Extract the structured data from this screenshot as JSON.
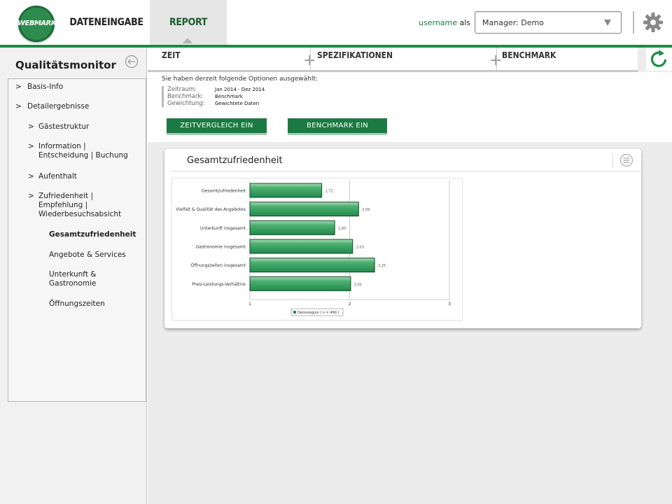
{
  "header": {
    "logo_text": "WEBMARK",
    "tabs": [
      {
        "label": "DATENEINGABE"
      },
      {
        "label": "REPORT"
      }
    ],
    "username_label": "username",
    "username_suffix": "als",
    "manager_select": {
      "value": "Manager: Demo"
    }
  },
  "sidebar": {
    "title": "Qualitätsmonitor",
    "items": [
      {
        "label": "Basis-Info"
      },
      {
        "label": "Detailergebnisse"
      },
      {
        "label": "Gästestruktur"
      },
      {
        "label": "Information |"
      },
      {
        "label": "Entscheidung | Buchung"
      },
      {
        "label": "Aufenthalt"
      },
      {
        "label": "Zufriedenheit |"
      },
      {
        "label": "Empfehlung |"
      },
      {
        "label": "Wiederbesuchsabsicht"
      },
      {
        "label": "Gesamtzufriedenheit"
      },
      {
        "label": "Angebote & Services"
      },
      {
        "label": "Unterkunft &"
      },
      {
        "label": "Gastronomie"
      },
      {
        "label": "Öffnungszeiten"
      }
    ]
  },
  "subtabs": [
    {
      "label": "ZEIT"
    },
    {
      "label": "SPEZIFIKATIONEN"
    },
    {
      "label": "BENCHMARK"
    }
  ],
  "options": {
    "title": "Sie haben derzeit folgende Optionen ausgewählt:",
    "rows": [
      {
        "key": "Zeitraum:",
        "value": "Jan 2014 - Dez 2014"
      },
      {
        "key": "Benchmark:",
        "value": "Benchmark"
      },
      {
        "key": "Gewichtung:",
        "value": "Gewichtete Daten"
      }
    ]
  },
  "buttons": {
    "zeitvergleich": "ZEITVERGLEICH EIN",
    "benchmark": "BENCHMARK EIN"
  },
  "card": {
    "title": "Gesamtzufriedenheit"
  },
  "chart_data": {
    "type": "bar",
    "orientation": "horizontal",
    "categories": [
      "Gesamtzufriedenheit",
      "Vielfalt & Qualität des Angebotes",
      "Unterkunft insgesamt",
      "Gastronomie insgesamt",
      "Öffnungszeiten insgesamt",
      "Preis-Leistungs-Verhältnis"
    ],
    "series": [
      {
        "name": "Demoregion ( n = 499 )",
        "values": [
          1.72,
          2.09,
          1.85,
          2.03,
          2.25,
          2.01
        ]
      }
    ],
    "value_labels": [
      "1,72",
      "2,09",
      "1,85",
      "2,03",
      "2,25",
      "2,01"
    ],
    "xlim": [
      1,
      3
    ],
    "xticks": [
      "1",
      "2",
      "3"
    ],
    "grid": true,
    "legend": "bottom",
    "colors": {
      "bar": "#1f8a4c",
      "bar_light": "#4fb072"
    }
  }
}
